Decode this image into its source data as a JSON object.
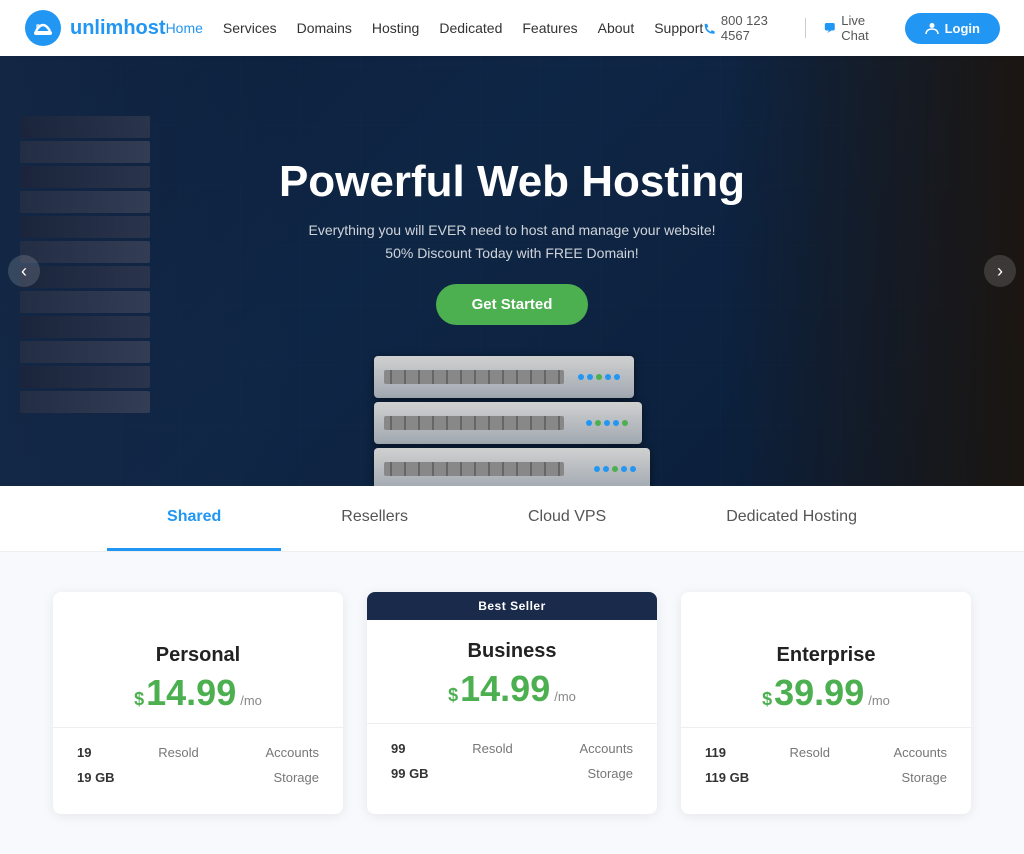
{
  "header": {
    "logo_text_part1": "unlim",
    "logo_text_part2": "host",
    "nav_items": [
      {
        "label": "Home",
        "active": true
      },
      {
        "label": "Services",
        "active": false
      },
      {
        "label": "Domains",
        "active": false
      },
      {
        "label": "Hosting",
        "active": false
      },
      {
        "label": "Dedicated",
        "active": false
      },
      {
        "label": "Features",
        "active": false
      },
      {
        "label": "About",
        "active": false
      },
      {
        "label": "Support",
        "active": false
      }
    ],
    "phone": "800 123 4567",
    "live_chat": "Live Chat",
    "login_label": "Login"
  },
  "hero": {
    "title": "Powerful Web Hosting",
    "subtitle_line1": "Everything you will EVER need to host and manage your website!",
    "subtitle_line2": "50% Discount Today with FREE Domain!",
    "cta_label": "Get Started",
    "arrow_left": "‹",
    "arrow_right": "›"
  },
  "tabs": [
    {
      "label": "Shared",
      "active": true
    },
    {
      "label": "Resellers",
      "active": false
    },
    {
      "label": "Cloud VPS",
      "active": false
    },
    {
      "label": "Dedicated Hosting",
      "active": false
    }
  ],
  "pricing": {
    "cards": [
      {
        "badge": "",
        "title": "Personal",
        "price": "14.99",
        "period": "/mo",
        "features": [
          {
            "label": "Resold",
            "value": "19",
            "unit": "Accounts"
          },
          {
            "label": "Storage",
            "value": "19 GB",
            "unit": ""
          }
        ]
      },
      {
        "badge": "Best Seller",
        "title": "Business",
        "price": "14.99",
        "period": "/mo",
        "features": [
          {
            "label": "Resold",
            "value": "99",
            "unit": "Accounts"
          },
          {
            "label": "Storage",
            "value": "99 GB",
            "unit": ""
          }
        ]
      },
      {
        "badge": "",
        "title": "Enterprise",
        "price": "39.99",
        "period": "/mo",
        "features": [
          {
            "label": "Resold",
            "value": "119",
            "unit": "Accounts"
          },
          {
            "label": "Storage",
            "value": "119 GB",
            "unit": ""
          }
        ]
      }
    ]
  }
}
